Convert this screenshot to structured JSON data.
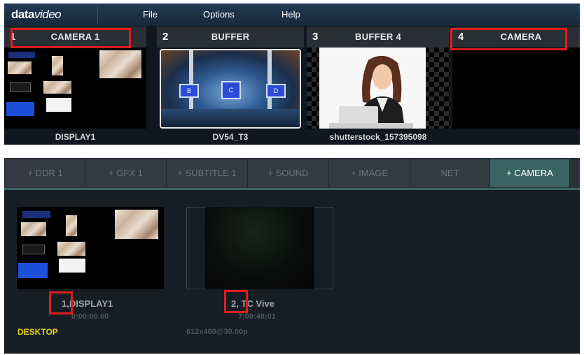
{
  "menubar": {
    "logo_part1": "data",
    "logo_part2": "video",
    "items": [
      "File",
      "Options",
      "Help"
    ]
  },
  "sources": [
    {
      "number": "1",
      "title": "CAMERA 1",
      "caption": "DISPLAY1"
    },
    {
      "number": "2",
      "title": "BUFFER",
      "caption": "DV54_T3"
    },
    {
      "number": "3",
      "title": "BUFFER 4",
      "caption": "shutterstock_157395098"
    },
    {
      "number": "4",
      "title": "CAMERA",
      "caption": ""
    }
  ],
  "stage_screens": [
    "B",
    "C",
    "D"
  ],
  "tabs": [
    "+ DDR 1",
    "+ GFX 1",
    "+ SUBTITLE 1",
    "+ SOUND",
    "+ IMAGE",
    "NET",
    "+ CAMERA"
  ],
  "active_tab": "+ CAMERA",
  "devices": [
    {
      "number": "1,",
      "name": "DISPLAY1",
      "timecode": "0:00:00.00"
    },
    {
      "number": "2,",
      "name": "TC Vive",
      "timecode": "7:09:48;01"
    }
  ],
  "desktop_label": "DESKTOP",
  "resolution": "612x460@30.00p",
  "colors": {
    "highlight": "#e11c1c",
    "active_tab": "#3b6363",
    "desktop_label": "#e8d21a"
  }
}
